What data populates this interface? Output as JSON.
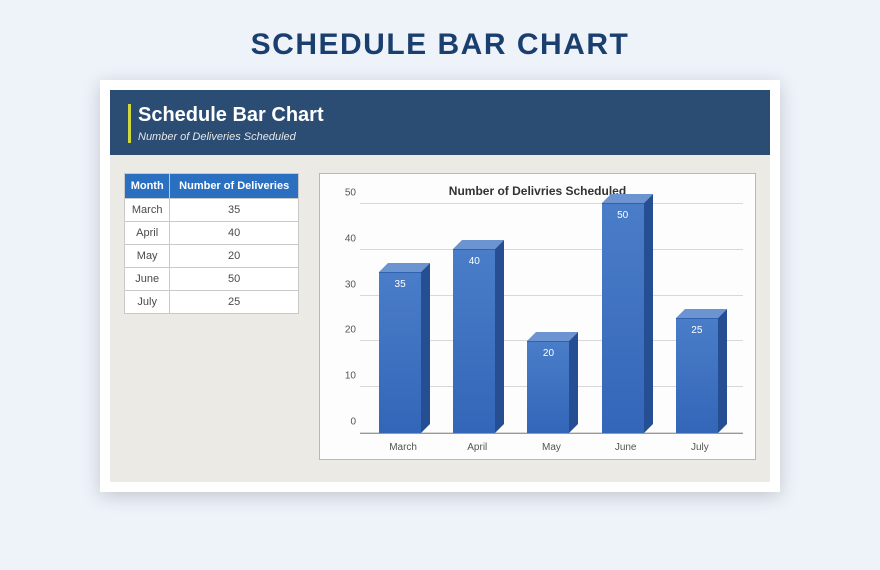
{
  "page": {
    "title": "SCHEDULE BAR CHART"
  },
  "banner": {
    "title": "Schedule Bar Chart",
    "subtitle": "Number of Deliveries Scheduled"
  },
  "table": {
    "headers": [
      "Month",
      "Number of Deliveries"
    ],
    "rows": [
      {
        "month": "March",
        "count": 35
      },
      {
        "month": "April",
        "count": 40
      },
      {
        "month": "May",
        "count": 20
      },
      {
        "month": "June",
        "count": 50
      },
      {
        "month": "July",
        "count": 25
      }
    ]
  },
  "chart_data": {
    "type": "bar",
    "title": "Number of Delivries Scheduled",
    "xlabel": "",
    "ylabel": "",
    "categories": [
      "March",
      "April",
      "May",
      "June",
      "July"
    ],
    "values": [
      35,
      40,
      20,
      50,
      25
    ],
    "ylim": [
      0,
      50
    ],
    "yticks": [
      0,
      10,
      20,
      30,
      40,
      50
    ],
    "colors": {
      "bar": "#3366b8",
      "banner": "#2b4d74",
      "accent": "#cfd93e"
    }
  }
}
